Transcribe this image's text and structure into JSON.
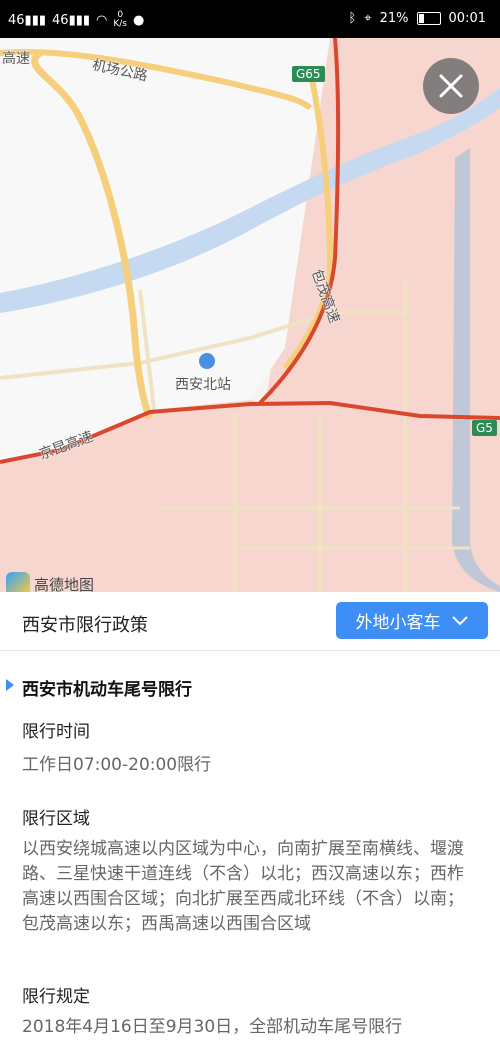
{
  "status_bar": {
    "signal1": "46",
    "signal2": "46",
    "speed_value": "0",
    "speed_unit": "K/s",
    "battery": "21%",
    "time": "00:01"
  },
  "map": {
    "labels": {
      "highway_top_left": "高速",
      "airport_road": "机场公路",
      "g65_top": "G65",
      "baomao": "包茂高速",
      "station": "西安北站",
      "jingkun": "京昆高速",
      "g65_right": "G5"
    },
    "logo_text": "高德地图"
  },
  "policy": {
    "city_title": "西安市限行政策",
    "vehicle_type": "外地小客车",
    "section_title": "西安市机动车尾号限行",
    "time_label": "限行时间",
    "time_value": "工作日07:00-20:00限行",
    "area_label": "限行区域",
    "area_value": "以西安绕城高速以内区域为中心，向南扩展至南横线、堰渡路、三星快速干道连线（不含）以北；西汉高速以东；西柞高速以西围合区域；向北扩展至西咸北环线（不含）以南；包茂高速以东；西禹高速以西围合区域",
    "rule_label": "限行规定",
    "rule_value": "2018年4月16日至9月30日，全部机动车尾号限行"
  }
}
